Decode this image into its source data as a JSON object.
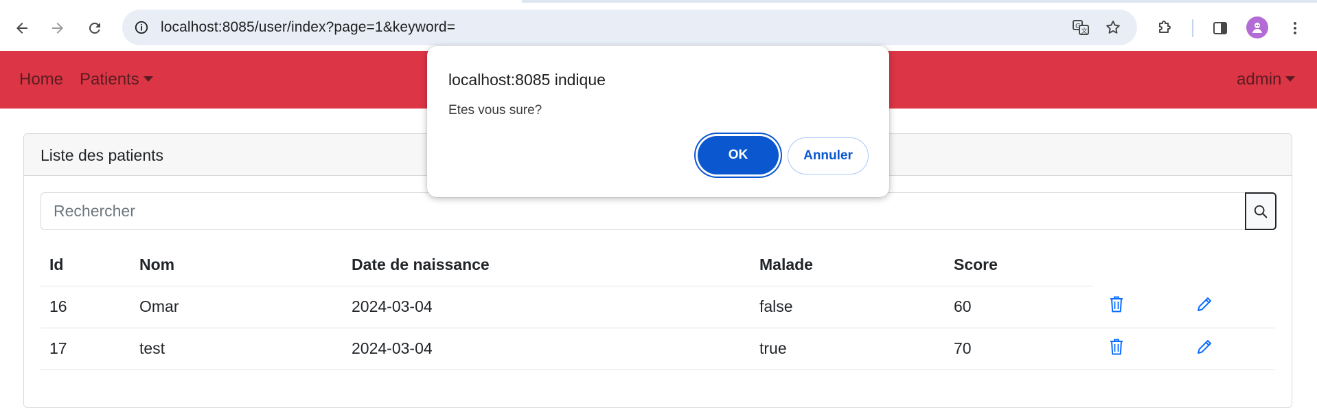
{
  "browser": {
    "url": "localhost:8085/user/index?page=1&keyword="
  },
  "navbar": {
    "home": "Home",
    "patients": "Patients",
    "user": "admin",
    "color": "#dc3545"
  },
  "card": {
    "title": "Liste des patients"
  },
  "search": {
    "placeholder": "Rechercher"
  },
  "table": {
    "headers": [
      "Id",
      "Nom",
      "Date de naissance",
      "Malade",
      "Score"
    ],
    "rows": [
      {
        "id": "16",
        "nom": "Omar",
        "date": "2024-03-04",
        "malade": "false",
        "score": "60"
      },
      {
        "id": "17",
        "nom": "test",
        "date": "2024-03-04",
        "malade": "true",
        "score": "70"
      }
    ]
  },
  "dialog": {
    "title": "localhost:8085 indique",
    "message": "Etes vous sure?",
    "ok_label": "OK",
    "cancel_label": "Annuler",
    "accent": "#0b57d0"
  }
}
